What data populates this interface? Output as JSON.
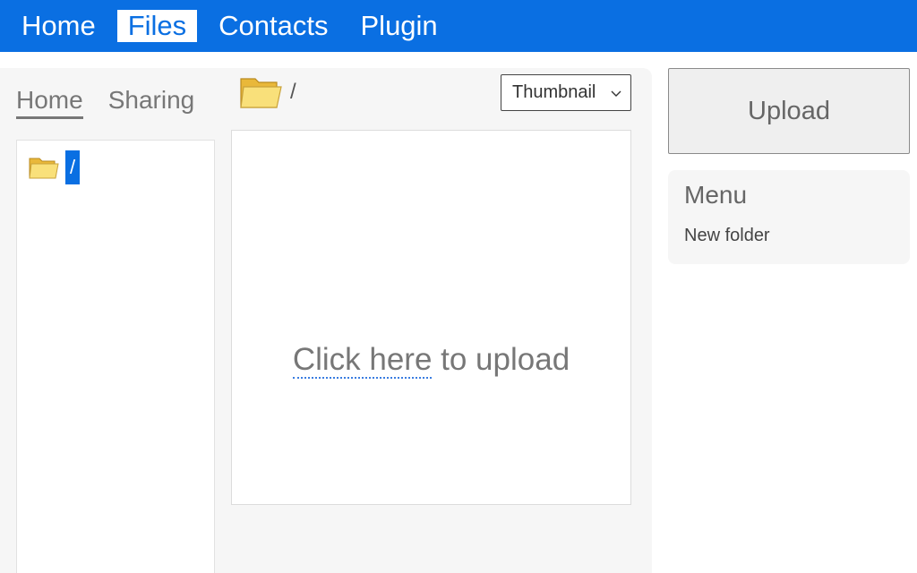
{
  "nav": {
    "items": [
      {
        "label": "Home"
      },
      {
        "label": "Files"
      },
      {
        "label": "Contacts"
      },
      {
        "label": "Plugin"
      }
    ],
    "active": "Files"
  },
  "tabs": {
    "items": [
      {
        "label": "Home"
      },
      {
        "label": "Sharing"
      }
    ],
    "active": "Home"
  },
  "tree": {
    "root_label": "/"
  },
  "path": {
    "current": "/"
  },
  "view_select": {
    "selected": "Thumbnail"
  },
  "drop_zone": {
    "link_text": "Click here",
    "rest_text": " to upload"
  },
  "sidebar": {
    "upload_label": "Upload",
    "menu_title": "Menu",
    "menu_items": [
      {
        "label": "New folder"
      }
    ]
  },
  "colors": {
    "accent": "#0a6fe2",
    "panel_bg": "#f6f6f6",
    "folder_yellow": "#f7d64a"
  },
  "icons": {
    "folder": "folder-icon",
    "dropdown": "chevron-down-icon"
  }
}
